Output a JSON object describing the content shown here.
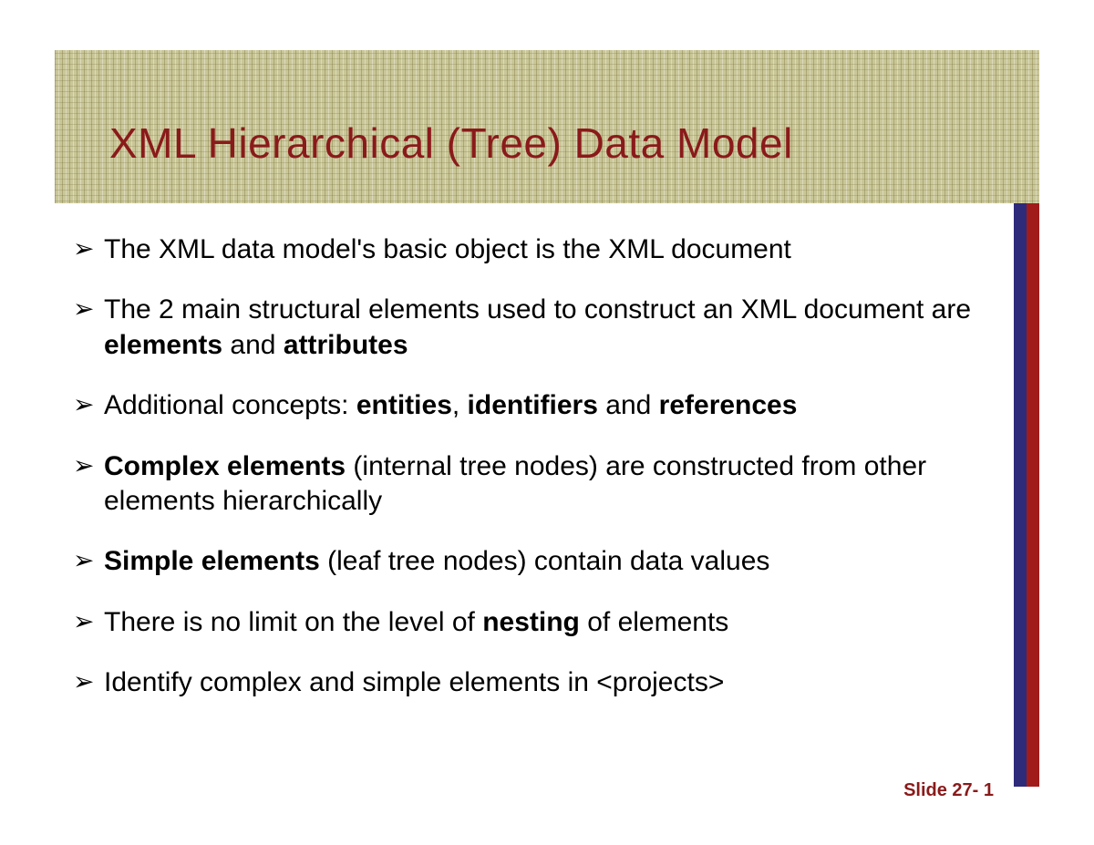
{
  "title": "XML Hierarchical (Tree) Data Model",
  "bullets": [
    {
      "html": "The XML data model's basic object is the XML document"
    },
    {
      "html": "The 2 main structural elements used to construct an XML document are <b>elements</b> and <b>attributes</b>"
    },
    {
      "html": "Additional concepts: <b>entities</b>, <b>identifiers</b> and <b>references</b>"
    },
    {
      "html": "<b>Complex elements</b> (internal tree nodes) are constructed from other elements hierarchically"
    },
    {
      "html": "<b>Simple elements</b> (leaf tree nodes) contain data values"
    },
    {
      "html": "There is no limit on the level of <b>nesting</b> of elements"
    },
    {
      "html": "Identify complex and simple elements in &lt;projects&gt;"
    }
  ],
  "footer": "Slide 27- 1"
}
